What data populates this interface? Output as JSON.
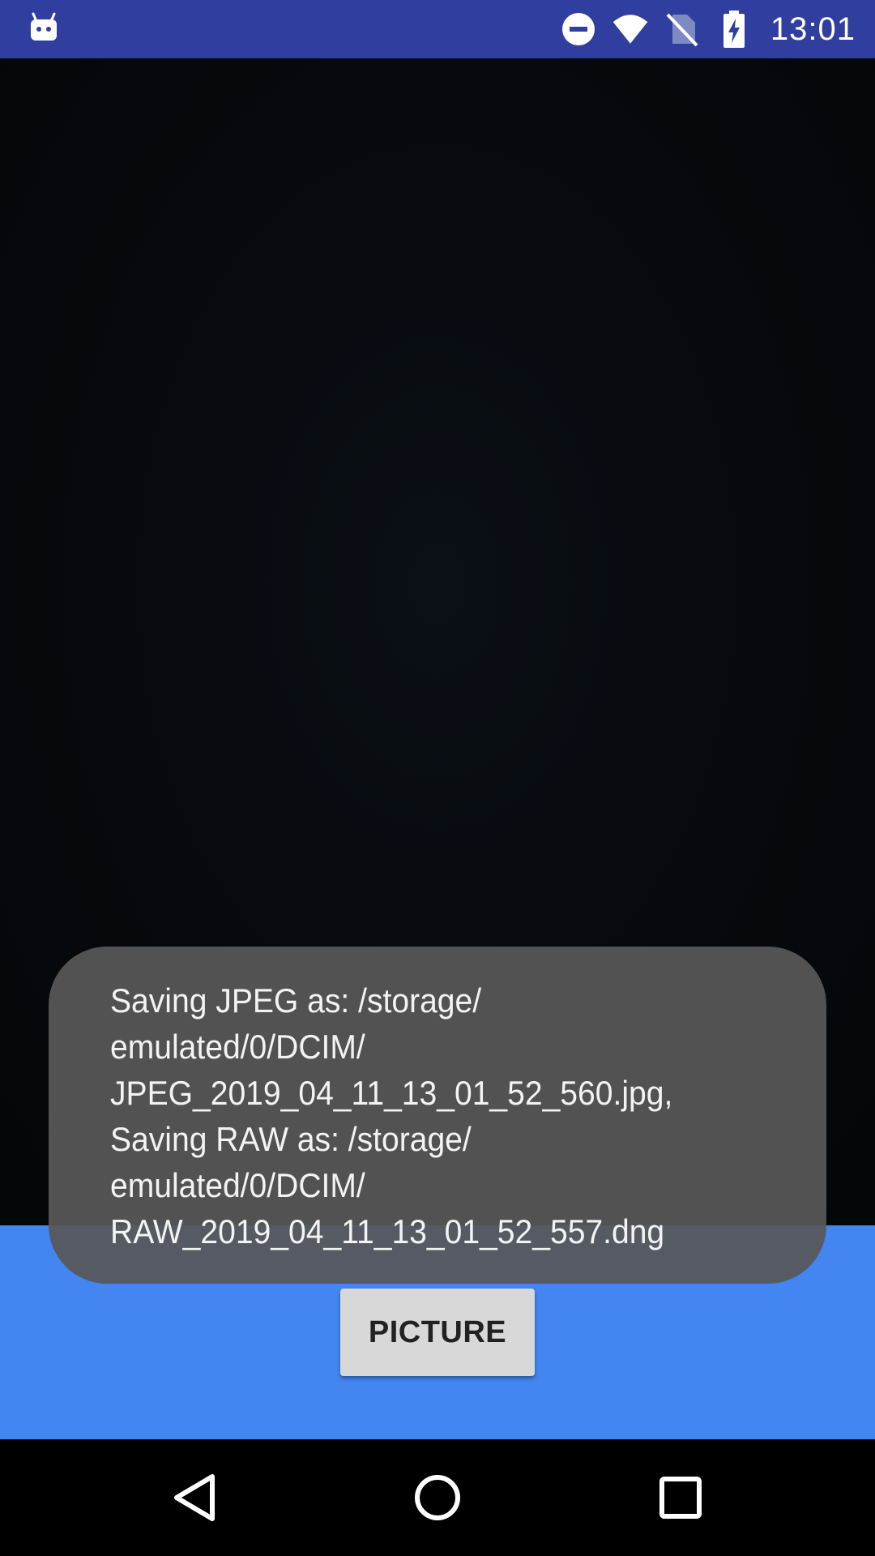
{
  "status_bar": {
    "time": "13:01",
    "background_color": "#303F9F",
    "left_icon": "android-debug-icon",
    "right_icons": [
      "do-not-disturb-icon",
      "wifi-icon",
      "no-sim-icon",
      "battery-charging-icon"
    ]
  },
  "toast": {
    "lines": [
      "Saving JPEG as: /storage/",
      "emulated/0/DCIM/",
      "JPEG_2019_04_11_13_01_52_560.jpg,",
      "Saving RAW as: /storage/",
      "emulated/0/DCIM/",
      "RAW_2019_04_11_13_01_52_557.dng"
    ]
  },
  "controls": {
    "picture_label": "PICTURE",
    "background_color": "#4386F1"
  },
  "nav_bar": {
    "buttons": [
      "back-icon",
      "home-icon",
      "recents-icon"
    ]
  }
}
